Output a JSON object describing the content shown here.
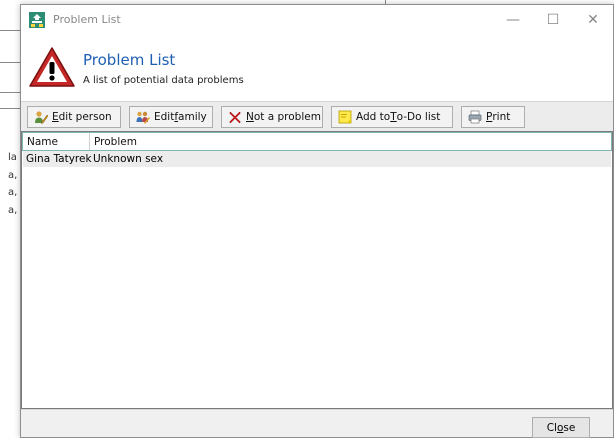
{
  "window": {
    "title": "Problem List",
    "minimize_glyph": "—",
    "maximize_glyph": "☐",
    "close_glyph": "✕"
  },
  "header": {
    "title": "Problem List",
    "subtitle": "A list of potential data problems",
    "icon": "warning-icon"
  },
  "toolbar": {
    "edit_person": {
      "pre": "",
      "key": "E",
      "post": "dit person",
      "icon": "edit-person-icon"
    },
    "edit_family": {
      "pre": "Edit ",
      "key": "f",
      "post": "amily",
      "icon": "edit-family-icon"
    },
    "not_a_problem": {
      "pre": "",
      "key": "N",
      "post": "ot a problem",
      "icon": "red-x-icon"
    },
    "add_todo": {
      "pre": "Add to ",
      "key": "T",
      "post": "o-Do list",
      "icon": "sticky-note-icon"
    },
    "print": {
      "pre": "",
      "key": "P",
      "post": "rint",
      "icon": "printer-icon"
    }
  },
  "list": {
    "columns": [
      "Name",
      "Problem"
    ],
    "rows": [
      {
        "name": "Gina Tatyrek",
        "problem": "Unknown sex"
      }
    ]
  },
  "footer": {
    "close": {
      "pre": "Cl",
      "key": "o",
      "post": "se"
    }
  },
  "background": {
    "left_chars": [
      "la",
      "a,",
      "a,",
      "a,"
    ]
  },
  "colors": {
    "title_blue": "#1f5fb3",
    "warning_red": "#c62828",
    "list_header_border": "#7fb7b2",
    "row_bg": "#ececec"
  }
}
